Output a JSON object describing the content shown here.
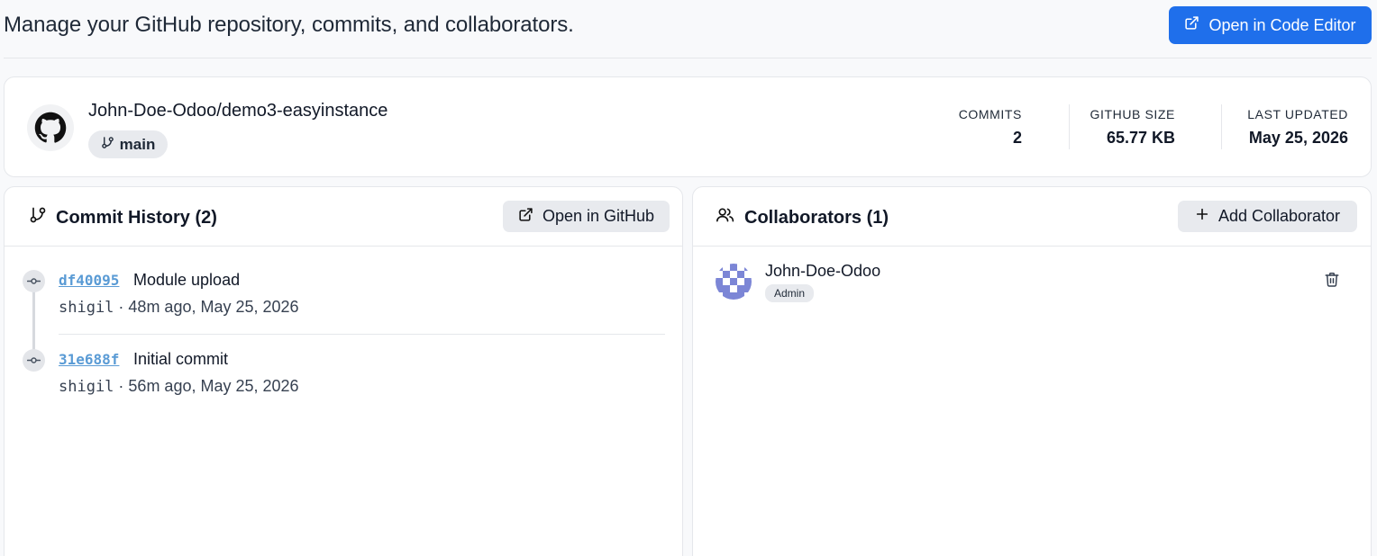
{
  "header": {
    "description": "Manage your GitHub repository, commits, and collaborators.",
    "open_editor_label": "Open in Code Editor",
    "accent_color": "#1f6feb"
  },
  "repo": {
    "icon": "github-icon",
    "name": "John-Doe-Odoo/demo3-easyinstance",
    "branch": "main",
    "stats": [
      {
        "label": "COMMITS",
        "value": "2"
      },
      {
        "label": "GITHUB SIZE",
        "value": "65.77 KB"
      },
      {
        "label": "LAST UPDATED",
        "value": "May 25, 2026"
      }
    ]
  },
  "commits_panel": {
    "title": "Commit History (2)",
    "open_github_label": "Open in GitHub",
    "commits": [
      {
        "sha": "df40095",
        "message": "Module upload",
        "author": "shigil",
        "meta": " · 48m ago, May 25, 2026"
      },
      {
        "sha": "31e688f",
        "message": "Initial commit",
        "author": "shigil",
        "meta": " · 56m ago, May 25, 2026"
      }
    ],
    "link_color": "#5a9bd5"
  },
  "collaborators_panel": {
    "title": "Collaborators (1)",
    "add_label": "Add Collaborator",
    "collaborators": [
      {
        "name": "John-Doe-Odoo",
        "role": "Admin",
        "avatar_color": "#7c86d6"
      }
    ]
  }
}
